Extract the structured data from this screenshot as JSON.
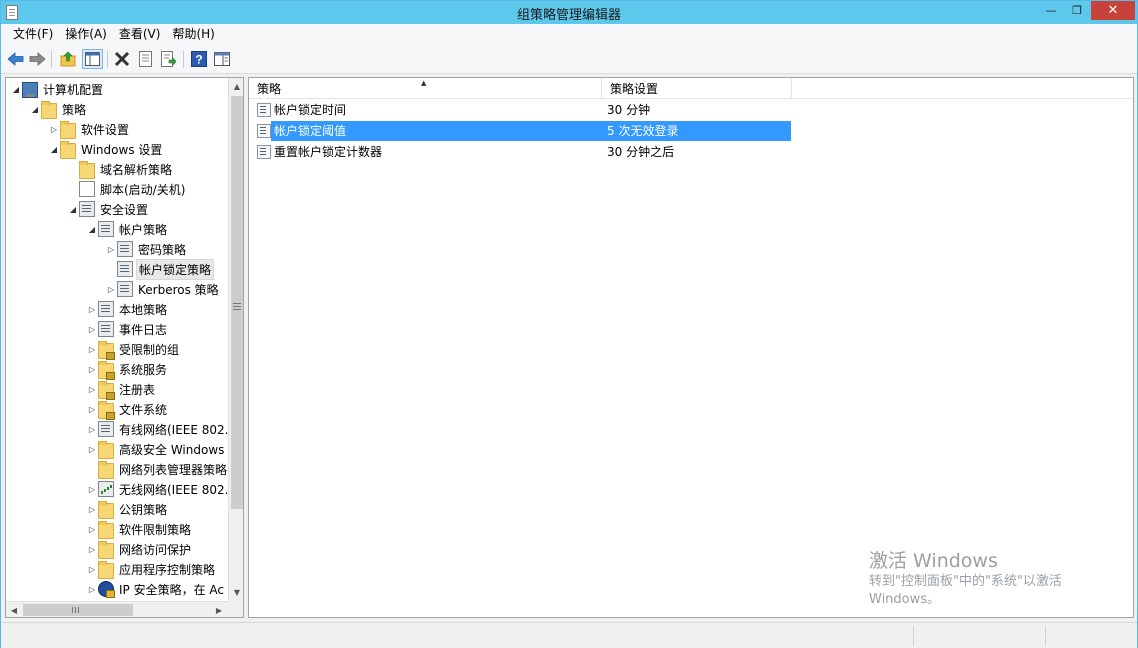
{
  "window": {
    "title": "组策略管理编辑器"
  },
  "menu": [
    "文件(F)",
    "操作(A)",
    "查看(V)",
    "帮助(H)"
  ],
  "toolbar": [
    "back-arrow-icon",
    "forward-arrow-icon",
    "up-folder-icon",
    "show-tree-icon",
    "delete-icon",
    "properties-icon",
    "export-icon",
    "help-icon",
    "console-view-icon"
  ],
  "tree": [
    {
      "label": "计算机配置",
      "exp": "◢",
      "icon": "comp"
    },
    {
      "label": "策略",
      "exp": "◢",
      "icon": "folder"
    },
    {
      "label": "软件设置",
      "exp": "▷",
      "icon": "folder"
    },
    {
      "label": "Windows 设置",
      "exp": "◢",
      "icon": "folder"
    },
    {
      "label": "域名解析策略",
      "exp": "",
      "icon": "folder"
    },
    {
      "label": "脚本(启动/关机)",
      "exp": "",
      "icon": "script"
    },
    {
      "label": "安全设置",
      "exp": "◢",
      "icon": "policy"
    },
    {
      "label": "帐户策略",
      "exp": "◢",
      "icon": "policy"
    },
    {
      "label": "密码策略",
      "exp": "▷",
      "icon": "policy"
    },
    {
      "label": "帐户锁定策略",
      "exp": "",
      "icon": "policy"
    },
    {
      "label": "Kerberos 策略",
      "exp": "▷",
      "icon": "policy"
    },
    {
      "label": "本地策略",
      "exp": "▷",
      "icon": "policy"
    },
    {
      "label": "事件日志",
      "exp": "▷",
      "icon": "policy"
    },
    {
      "label": "受限制的组",
      "exp": "▷",
      "icon": "folder-lock"
    },
    {
      "label": "系统服务",
      "exp": "▷",
      "icon": "folder-lock"
    },
    {
      "label": "注册表",
      "exp": "▷",
      "icon": "folder-lock"
    },
    {
      "label": "文件系统",
      "exp": "▷",
      "icon": "folder-lock"
    },
    {
      "label": "有线网络(IEEE 802.",
      "exp": "▷",
      "icon": "policy"
    },
    {
      "label": "高级安全 Windows",
      "exp": "▷",
      "icon": "folder"
    },
    {
      "label": "网络列表管理器策略",
      "exp": "",
      "icon": "folder"
    },
    {
      "label": "无线网络(IEEE 802.",
      "exp": "▷",
      "icon": "wifi"
    },
    {
      "label": "公钥策略",
      "exp": "▷",
      "icon": "folder"
    },
    {
      "label": "软件限制策略",
      "exp": "▷",
      "icon": "folder"
    },
    {
      "label": "网络访问保护",
      "exp": "▷",
      "icon": "folder"
    },
    {
      "label": "应用程序控制策略",
      "exp": "▷",
      "icon": "folder"
    },
    {
      "label": "IP 安全策略，在 Ac",
      "exp": "▷",
      "icon": "ipsec"
    }
  ],
  "list": {
    "columns": [
      "策略",
      "策略设置"
    ],
    "rows": [
      {
        "name": "帐户锁定时间",
        "setting": "30 分钟"
      },
      {
        "name": "帐户锁定阈值",
        "setting": "5 次无效登录"
      },
      {
        "name": "重置帐户锁定计数器",
        "setting": "30 分钟之后"
      }
    ]
  },
  "watermark": {
    "title": "激活 Windows",
    "line1": "转到\"控制面板\"中的\"系统\"以激活",
    "line2": "Windows。"
  }
}
